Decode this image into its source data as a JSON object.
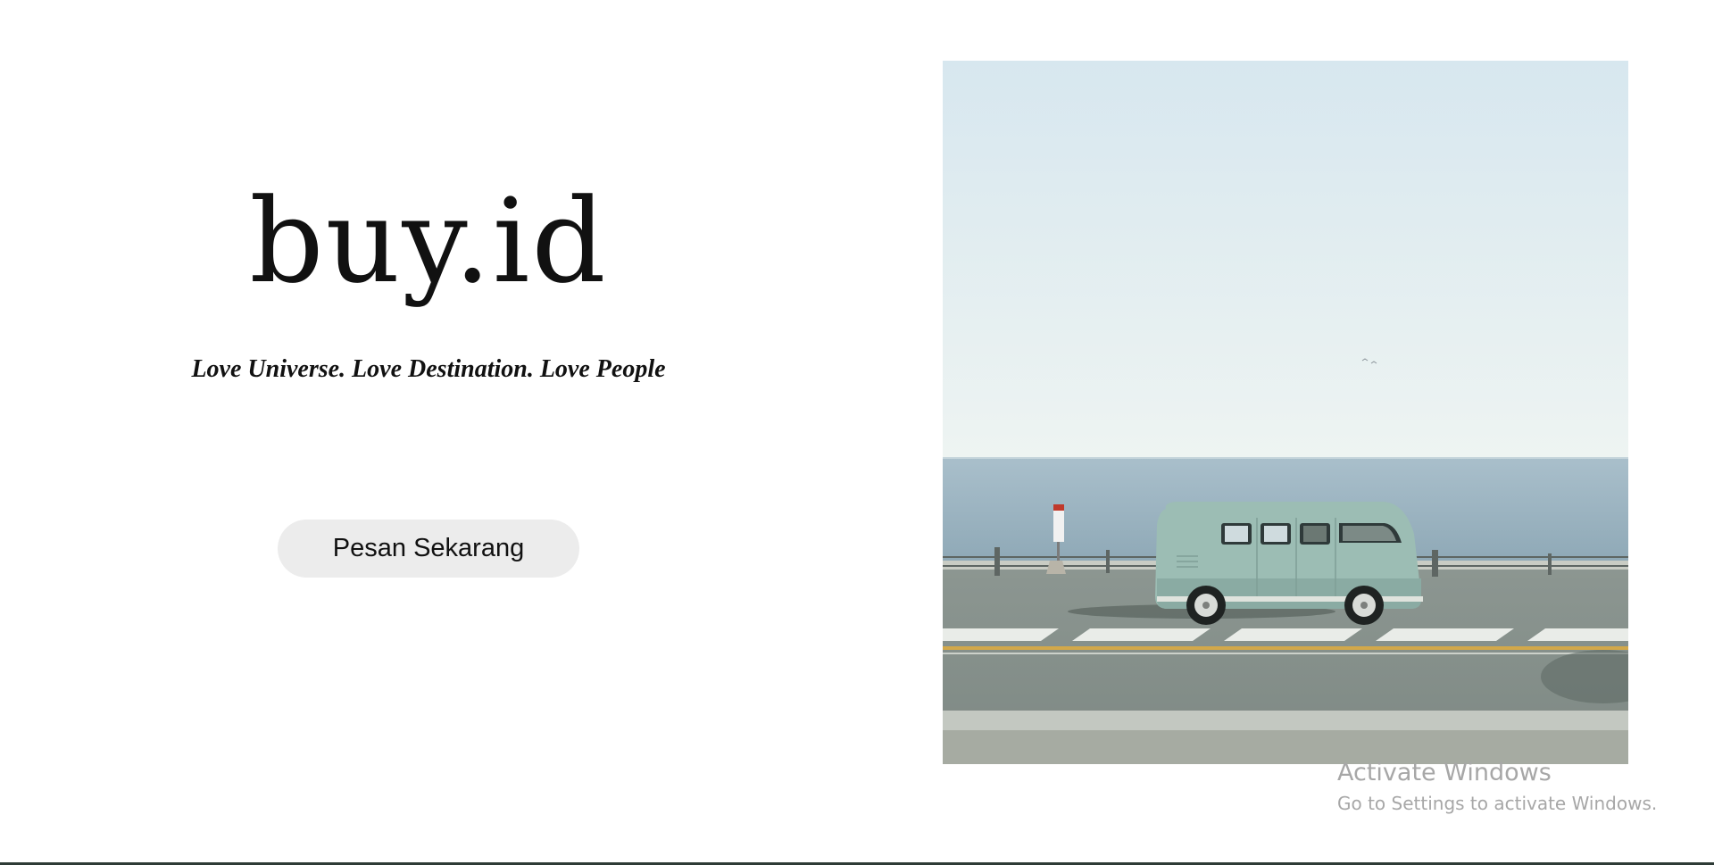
{
  "hero": {
    "brand": "buy.id",
    "tagline": "Love Universe. Love Destination. Love People",
    "cta_label": "Pesan Sekarang"
  },
  "photo": {
    "subject": "van-by-sea"
  },
  "os_watermark": {
    "title": "Activate Windows",
    "subtitle": "Go to Settings to activate Windows."
  },
  "colors": {
    "text": "#111111",
    "button_bg": "#ececec",
    "sky": "#dce9ef",
    "sea": "#9fb6c2",
    "road": "#8b9690",
    "van": "#9cbdb4",
    "watermark": "#a7a7a7"
  }
}
